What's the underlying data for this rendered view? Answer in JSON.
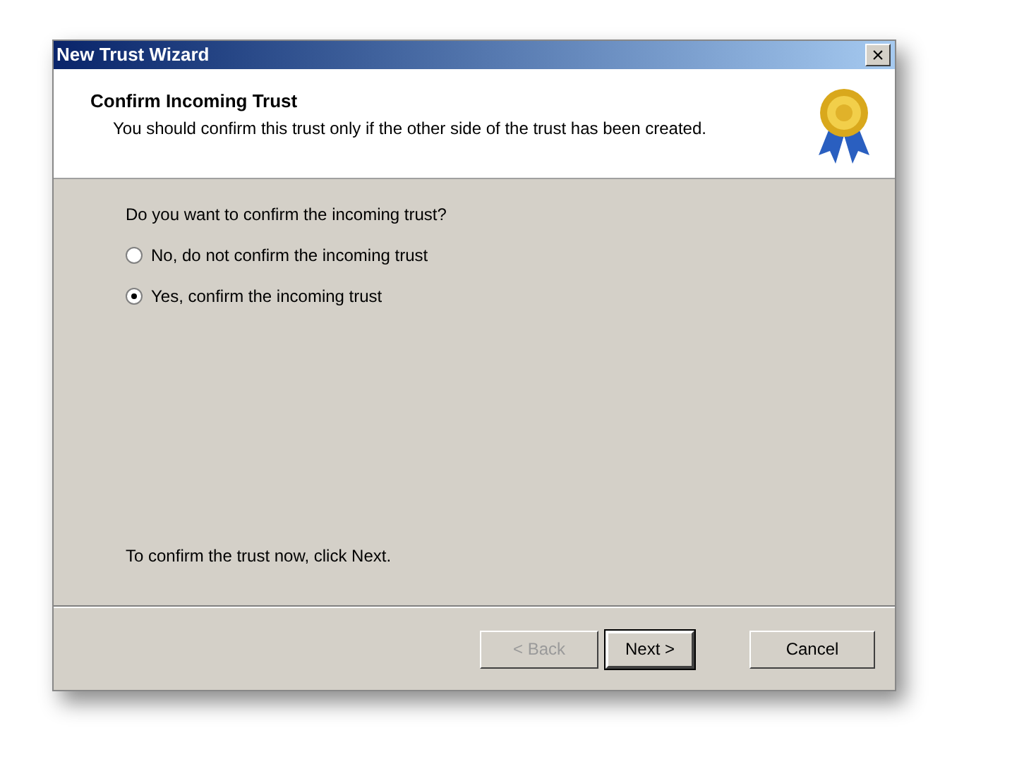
{
  "window": {
    "title": "New Trust Wizard",
    "close": "×"
  },
  "header": {
    "title": "Confirm Incoming Trust",
    "subtitle": "You should confirm this trust only if the other side of the trust has been created."
  },
  "question": "Do you want to confirm the incoming trust?",
  "options": [
    {
      "label": "No, do not confirm the incoming trust",
      "selected": false
    },
    {
      "label": "Yes, confirm the incoming trust",
      "selected": true
    }
  ],
  "hint": "To confirm the trust now, click Next.",
  "buttons": [
    {
      "label": "< Back",
      "disabled": true,
      "default": false
    },
    {
      "label": "Next >",
      "disabled": false,
      "default": true
    },
    {
      "label": "Cancel",
      "disabled": false,
      "default": false
    }
  ]
}
